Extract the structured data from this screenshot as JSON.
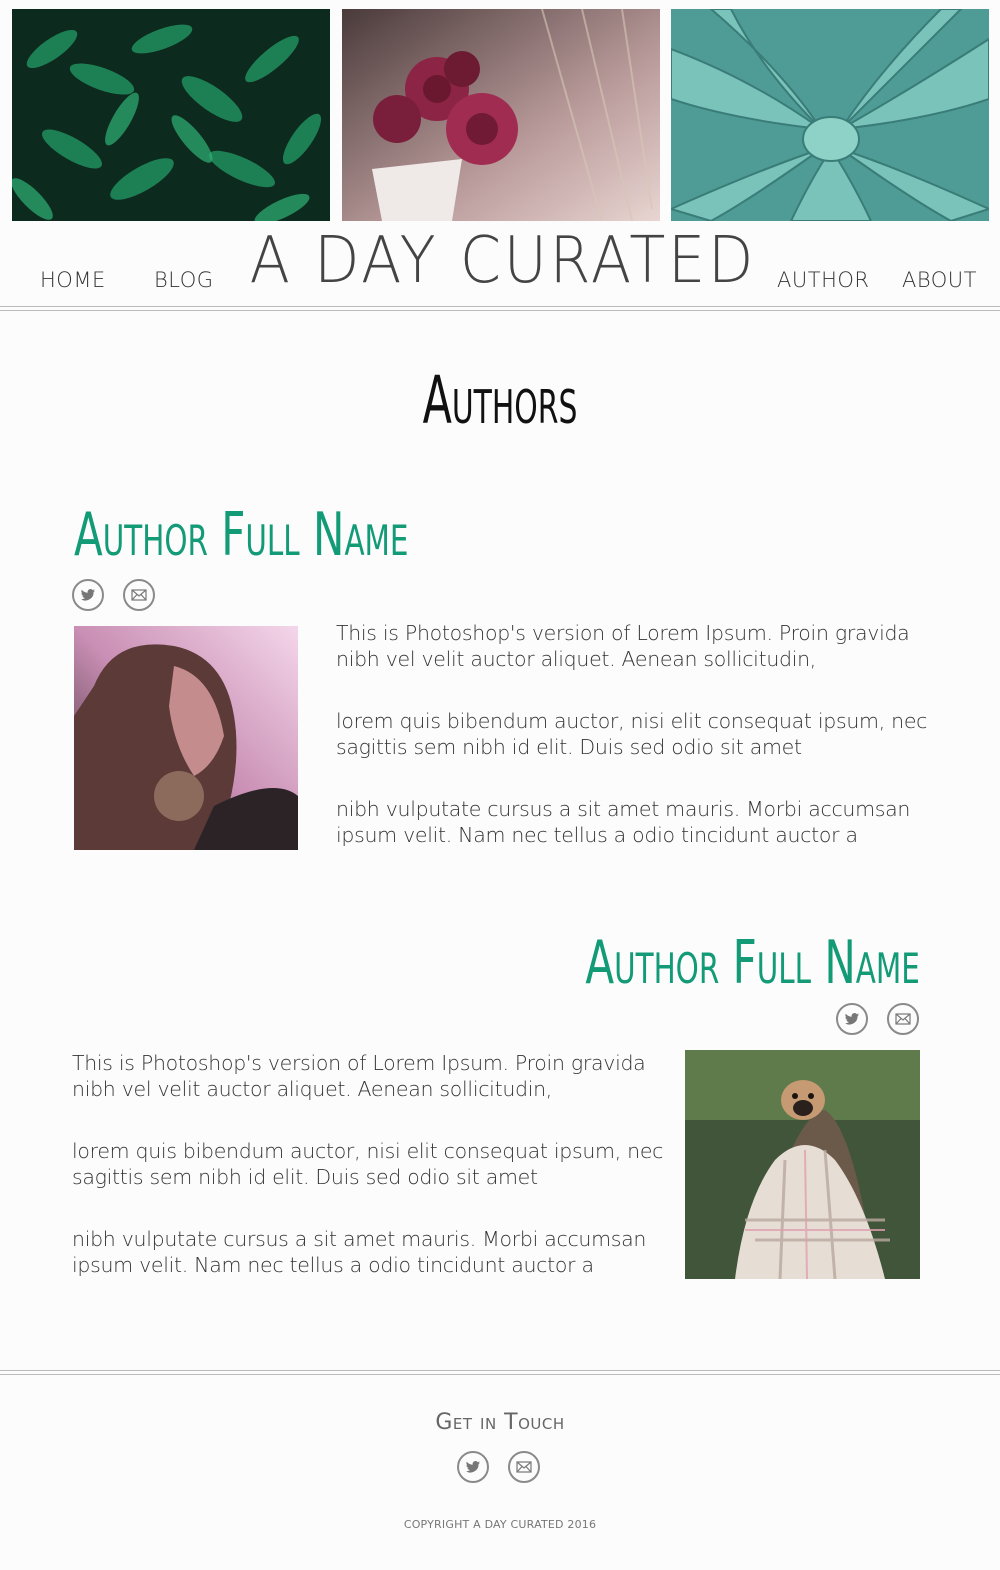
{
  "header": {
    "brand": "A DAY CURATED",
    "nav": {
      "home": "HOME",
      "blog": "BLOG",
      "author": "AUTHOR",
      "about": "ABOUT"
    },
    "photos": [
      "green-leaves-photo",
      "pink-roses-photo",
      "succulent-photo"
    ]
  },
  "main": {
    "title": "Authors",
    "authors": [
      {
        "name": "Author Full Name",
        "photo": "woman-portrait-photo",
        "paragraphs": [
          "This is Photoshop's version  of Lorem Ipsum. Proin gravida nibh vel velit auctor aliquet. Aenean sollicitudin,",
          "lorem quis bibendum auctor, nisi elit consequat ipsum, nec sagittis sem nibh id elit. Duis sed odio sit amet",
          "nibh vulputate cursus a sit amet mauris. Morbi accumsan ipsum velit. Nam nec tellus a odio tincidunt auctor a"
        ]
      },
      {
        "name": "Author Full Name",
        "photo": "pug-in-blanket-photo",
        "paragraphs": [
          "This is Photoshop's version  of Lorem Ipsum. Proin gravida nibh vel velit auctor aliquet. Aenean sollicitudin,",
          "lorem quis bibendum auctor, nisi elit consequat ipsum, nec sagittis sem nibh id elit. Duis sed odio sit amet",
          "nibh vulputate cursus a sit amet mauris. Morbi accumsan ipsum velit. Nam nec tellus a odio tincidunt auctor a"
        ]
      }
    ]
  },
  "footer": {
    "title": "Get in Touch",
    "copyright": "COPYRIGHT A DAY CURATED 2016"
  },
  "colors": {
    "accent": "#139a76",
    "text": "#333333",
    "rule": "#bbbbbb"
  }
}
